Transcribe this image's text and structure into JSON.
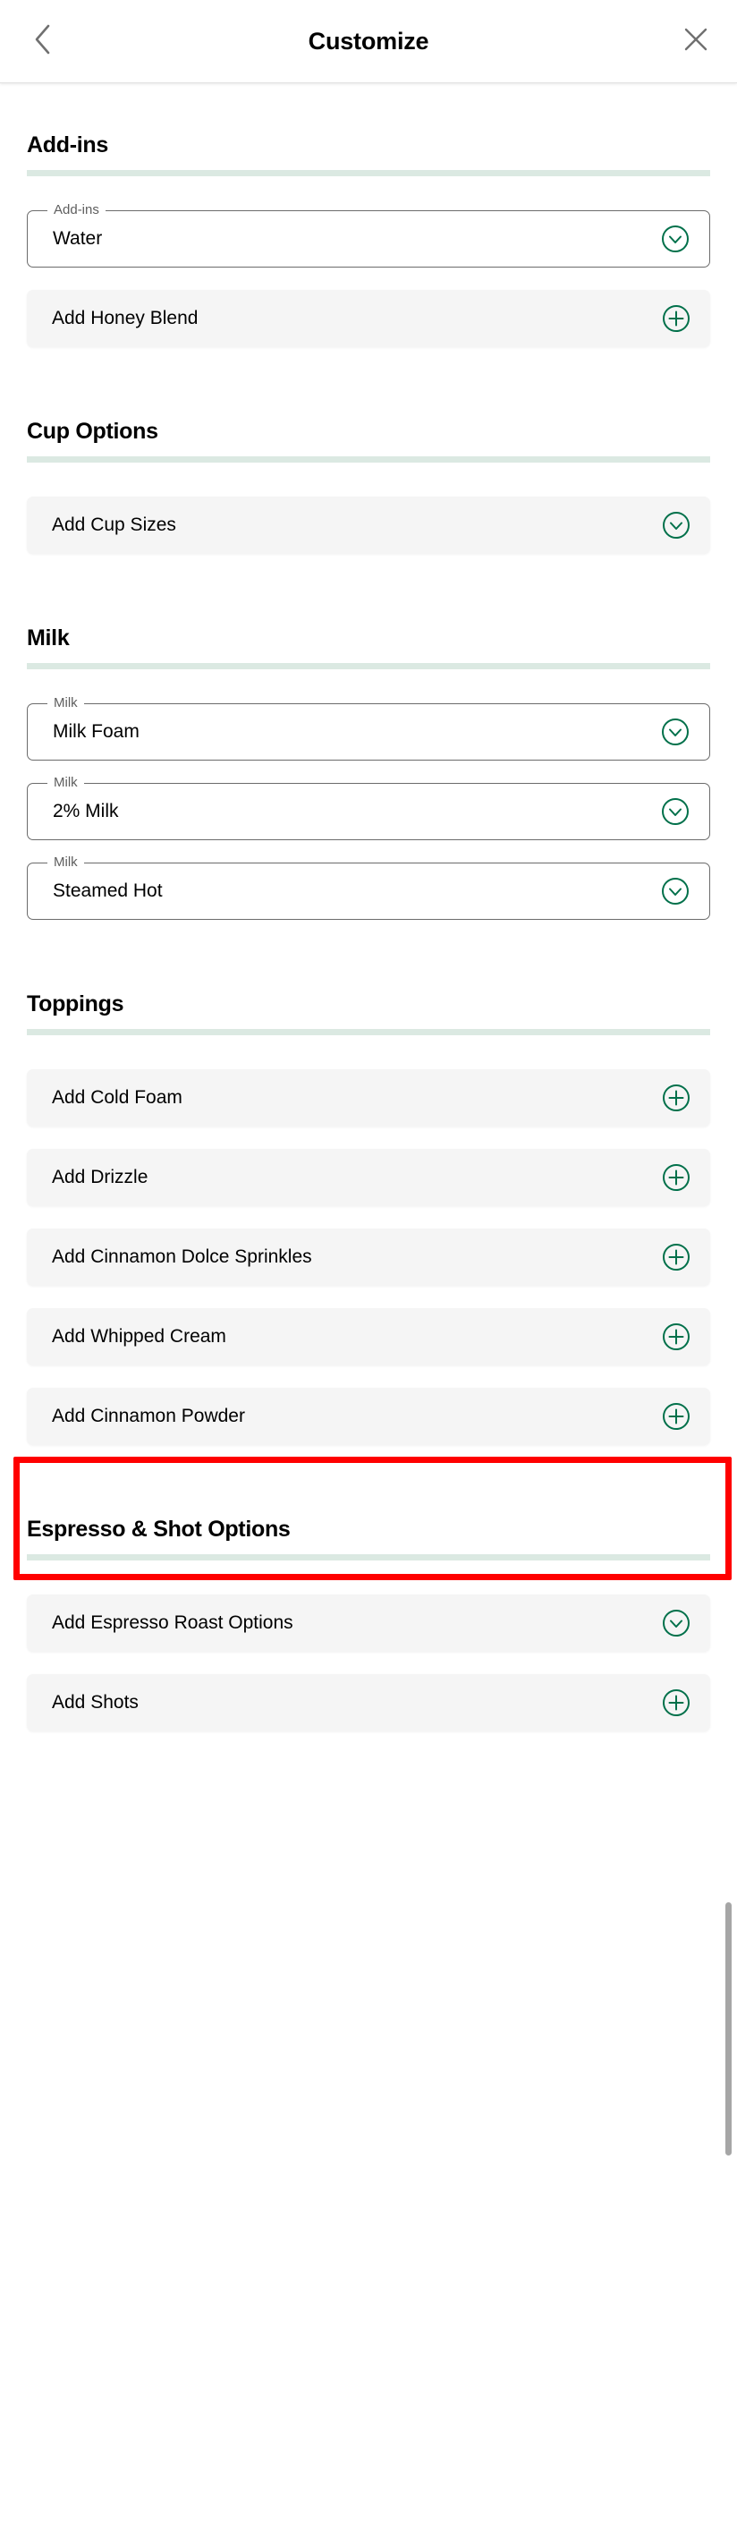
{
  "header": {
    "title": "Customize",
    "back_icon": "chevron-left-icon",
    "close_icon": "close-icon"
  },
  "colors": {
    "brand_green": "#00704A",
    "section_rule": "#dbe9e2",
    "row_background": "#f5f5f5",
    "field_border": "#6b6b6b",
    "highlight": "#ff0000",
    "scrollbar": "#a6a6a6"
  },
  "sections": [
    {
      "title": "Add-ins",
      "controls": [
        {
          "kind": "select",
          "legend": "Add-ins",
          "value": "Water",
          "icon": "chevron-down-circle-icon"
        },
        {
          "kind": "row",
          "label": "Add Honey Blend",
          "icon": "plus-circle-icon"
        }
      ]
    },
    {
      "title": "Cup Options",
      "controls": [
        {
          "kind": "row",
          "label": "Add Cup Sizes",
          "icon": "chevron-down-circle-icon"
        }
      ]
    },
    {
      "title": "Milk",
      "controls": [
        {
          "kind": "select",
          "legend": "Milk",
          "value": "Milk Foam",
          "icon": "chevron-down-circle-icon"
        },
        {
          "kind": "select",
          "legend": "Milk",
          "value": "2% Milk",
          "icon": "chevron-down-circle-icon"
        },
        {
          "kind": "select",
          "legend": "Milk",
          "value": "Steamed Hot",
          "icon": "chevron-down-circle-icon"
        }
      ]
    },
    {
      "title": "Toppings",
      "controls": [
        {
          "kind": "row",
          "label": "Add Cold Foam",
          "icon": "plus-circle-icon",
          "highlighted": true
        },
        {
          "kind": "row",
          "label": "Add Drizzle",
          "icon": "plus-circle-icon"
        },
        {
          "kind": "row",
          "label": "Add Cinnamon Dolce Sprinkles",
          "icon": "plus-circle-icon"
        },
        {
          "kind": "row",
          "label": "Add Whipped Cream",
          "icon": "plus-circle-icon"
        },
        {
          "kind": "row",
          "label": "Add Cinnamon Powder",
          "icon": "plus-circle-icon"
        }
      ]
    },
    {
      "title": "Espresso & Shot Options",
      "controls": [
        {
          "kind": "row",
          "label": "Add Espresso Roast Options",
          "icon": "chevron-down-circle-icon"
        },
        {
          "kind": "row",
          "label": "Add Shots",
          "icon": "plus-circle-icon"
        }
      ]
    }
  ]
}
